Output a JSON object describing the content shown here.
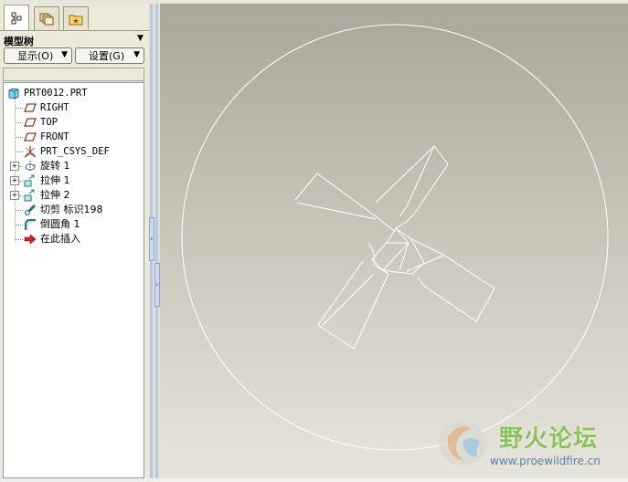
{
  "panel": {
    "title": "模型树",
    "tabs": [
      "model-tree-tab",
      "layers-tab",
      "favorites-tab"
    ],
    "show_button": "显示(O)",
    "settings_button": "设置(G)"
  },
  "tree": {
    "root": "PRT0012.PRT",
    "items": [
      {
        "label": "RIGHT",
        "icon": "datum-plane-icon",
        "expandable": false
      },
      {
        "label": "TOP",
        "icon": "datum-plane-icon",
        "expandable": false
      },
      {
        "label": "FRONT",
        "icon": "datum-plane-icon",
        "expandable": false
      },
      {
        "label": "PRT_CSYS_DEF",
        "icon": "csys-icon",
        "expandable": false
      },
      {
        "label": "旋转 1",
        "icon": "revolve-icon",
        "expandable": true
      },
      {
        "label": "拉伸 1",
        "icon": "extrude-icon",
        "expandable": true
      },
      {
        "label": "拉伸 2",
        "icon": "extrude-icon",
        "expandable": true
      },
      {
        "label": "切剪 标识198",
        "icon": "cut-icon",
        "expandable": false
      },
      {
        "label": "倒圆角 1",
        "icon": "round-icon",
        "expandable": false
      },
      {
        "label": "在此插入",
        "icon": "insert-here-icon",
        "expandable": false
      }
    ]
  },
  "watermark": {
    "title": "野火论坛",
    "url": "www.proewildfire.cn"
  },
  "colors": {
    "panel_bg": "#ece9d8",
    "tree_bg": "#ffffff",
    "viewport_top": "#a9a79a",
    "viewport_bottom": "#e6e5dc",
    "geometry": "#ffffff",
    "watermark_text": "#7aa84a"
  }
}
